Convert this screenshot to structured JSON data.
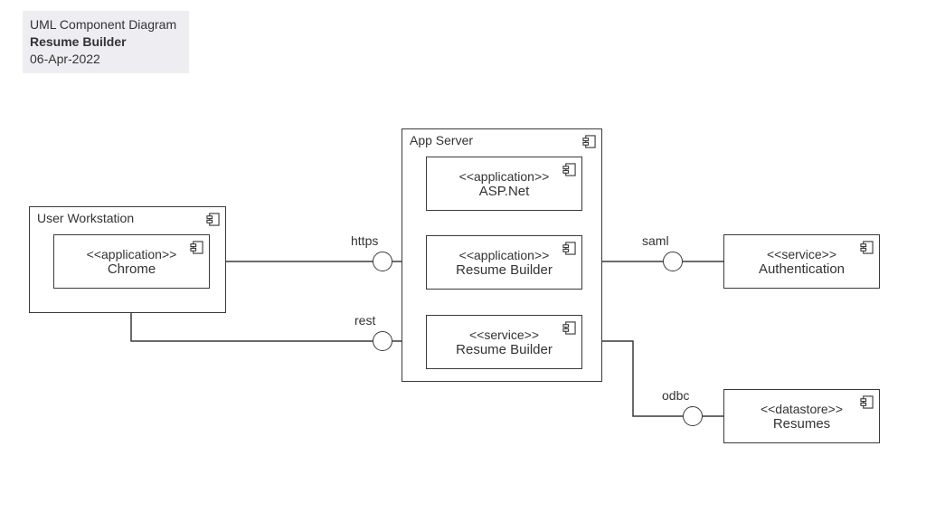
{
  "header": {
    "line1": "UML Component Diagram",
    "line2": "Resume Builder",
    "line3": "06-Apr-2022"
  },
  "nodes": {
    "userWorkstation": {
      "title": "User Workstation"
    },
    "appServer": {
      "title": "App Server"
    }
  },
  "components": {
    "chrome": {
      "stereotype": "<<application>>",
      "name": "Chrome"
    },
    "aspnet": {
      "stereotype": "<<application>>",
      "name": "ASP.Net"
    },
    "resumeApp": {
      "stereotype": "<<application>>",
      "name": "Resume Builder"
    },
    "resumeSvc": {
      "stereotype": "<<service>>",
      "name": "Resume Builder"
    },
    "auth": {
      "stereotype": "<<service>>",
      "name": "Authentication"
    },
    "resumes": {
      "stereotype": "<<datastore>>",
      "name": "Resumes"
    }
  },
  "interfaces": {
    "https": {
      "label": "https"
    },
    "rest": {
      "label": "rest"
    },
    "saml": {
      "label": "saml"
    },
    "odbc": {
      "label": "odbc"
    }
  }
}
